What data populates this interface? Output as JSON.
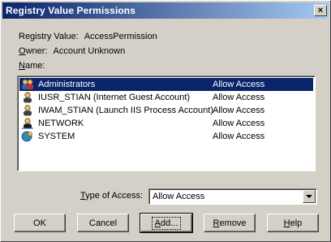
{
  "window": {
    "title": "Registry Value Permissions",
    "close_glyph": "×"
  },
  "info": {
    "registry_value_label": "Registry Value:",
    "registry_value": "AccessPermission",
    "owner_label_first": "O",
    "owner_label_rest": "wner:",
    "owner_value": "Account Unknown",
    "name_label_first": "N",
    "name_label_rest": "ame:"
  },
  "entries": [
    {
      "name": "Administrators",
      "access": "Allow Access",
      "icon": "group-icon",
      "selected": true
    },
    {
      "name": "IUSR_STIAN (Internet Guest Account)",
      "access": "Allow Access",
      "icon": "user-icon",
      "selected": false
    },
    {
      "name": "IWAM_STIAN (Launch IIS Process Account)",
      "access": "Allow Access",
      "icon": "user-icon",
      "selected": false
    },
    {
      "name": "NETWORK",
      "access": "Allow Access",
      "icon": "network-user-icon",
      "selected": false
    },
    {
      "name": "SYSTEM",
      "access": "Allow Access",
      "icon": "system-icon",
      "selected": false
    }
  ],
  "type_of_access": {
    "label_first": "T",
    "label_rest": "ype of Access:",
    "value": "Allow Access"
  },
  "buttons": {
    "ok": "OK",
    "cancel": "Cancel",
    "add_first": "A",
    "add_rest": "dd...",
    "remove_first": "R",
    "remove_rest": "emove",
    "help_first": "H",
    "help_rest": "elp"
  }
}
